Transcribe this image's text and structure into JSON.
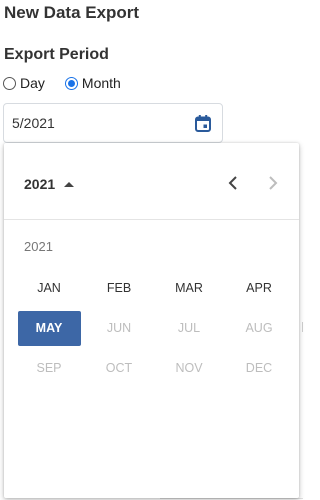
{
  "page": {
    "title": "New Data Export",
    "section_title": "Export Period"
  },
  "period": {
    "options": [
      {
        "label": "Day",
        "checked": false
      },
      {
        "label": "Month",
        "checked": true
      }
    ]
  },
  "date_field": {
    "value": "5/2021",
    "icon": "calendar-icon"
  },
  "picker": {
    "header_year": "2021",
    "year_label": "2021",
    "months": [
      {
        "label": "JAN",
        "state": "enabled"
      },
      {
        "label": "FEB",
        "state": "enabled"
      },
      {
        "label": "MAR",
        "state": "enabled"
      },
      {
        "label": "APR",
        "state": "enabled"
      },
      {
        "label": "MAY",
        "state": "selected"
      },
      {
        "label": "JUN",
        "state": "disabled"
      },
      {
        "label": "JUL",
        "state": "disabled"
      },
      {
        "label": "AUG",
        "state": "disabled"
      },
      {
        "label": "SEP",
        "state": "disabled"
      },
      {
        "label": "OCT",
        "state": "disabled"
      },
      {
        "label": "NOV",
        "state": "disabled"
      },
      {
        "label": "DEC",
        "state": "disabled"
      }
    ]
  },
  "colors": {
    "selected": "#3d67a6",
    "radio": "#1a73e8",
    "icon": "#2a5a9b"
  }
}
